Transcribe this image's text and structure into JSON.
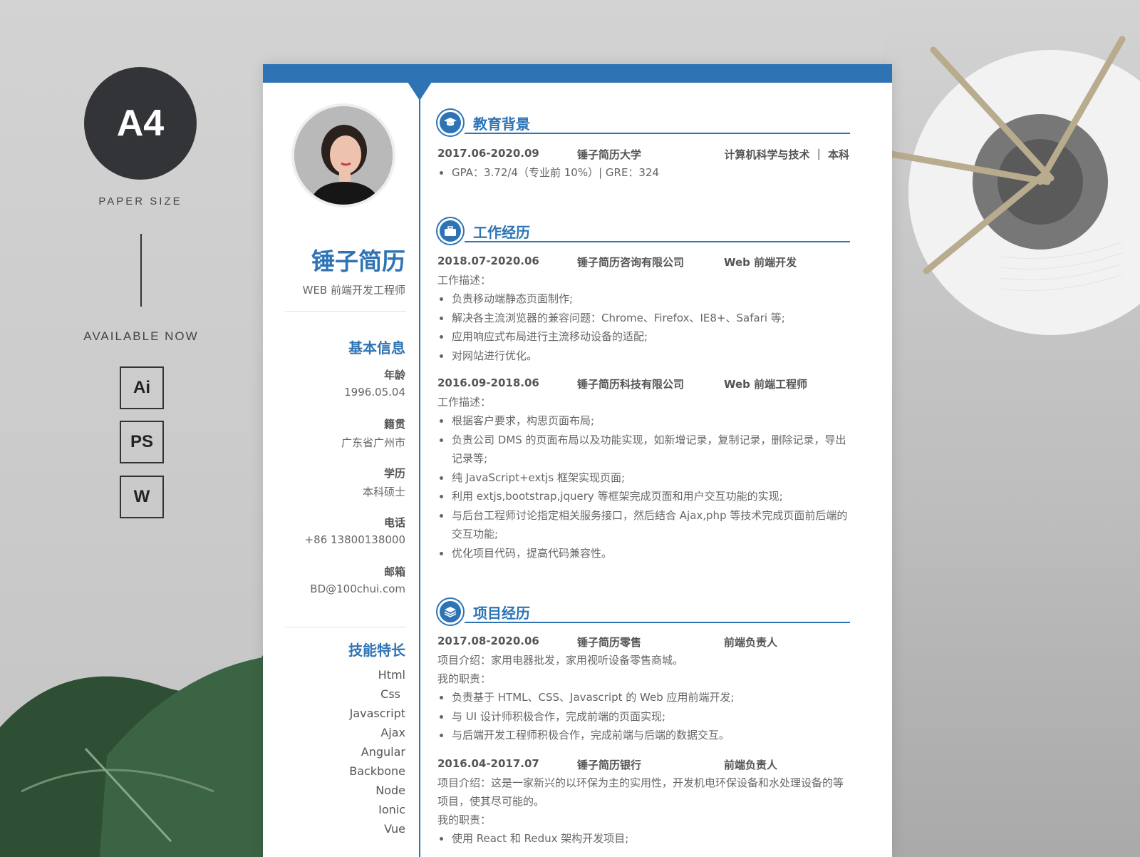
{
  "promo": {
    "badge": "A4",
    "paper_size": "PAPER SIZE",
    "available": "AVAILABLE NOW",
    "formats": [
      "Ai",
      "PS",
      "W"
    ]
  },
  "profile": {
    "name": "锤子简历",
    "role": "WEB 前端开发工程师"
  },
  "basic_info": {
    "heading": "基本信息",
    "items": [
      {
        "label": "年龄",
        "value": "1996.05.04"
      },
      {
        "label": "籍贯",
        "value": "广东省广州市"
      },
      {
        "label": "学历",
        "value": "本科硕士"
      },
      {
        "label": "电话",
        "value": "+86  13800138000"
      },
      {
        "label": "邮箱",
        "value": "BD@100chui.com"
      }
    ]
  },
  "skills": {
    "heading": "技能特长",
    "items": [
      "Html",
      "Css",
      "Javascript",
      "Ajax",
      "Angular",
      "Backbone",
      "Node",
      "Ionic",
      "Vue"
    ]
  },
  "education": {
    "heading": "教育背景",
    "date": "2017.06-2020.09",
    "school": "锤子简历大学",
    "major": "计算机科学与技术 ｜ 本科",
    "bullets": [
      "GPA：3.72/4（专业前 10%）| GRE：324"
    ]
  },
  "work": {
    "heading": "工作经历",
    "jobs": [
      {
        "date": "2018.07-2020.06",
        "company": "锤子简历咨询有限公司",
        "position": "Web 前端开发",
        "desc_label": "工作描述：",
        "bullets": [
          "负责移动端静态页面制作;",
          "解决各主流浏览器的兼容问题：Chrome、Firefox、IE8+、Safari 等;",
          "应用响应式布局进行主流移动设备的适配;",
          "对网站进行优化。"
        ]
      },
      {
        "date": "2016.09-2018.06",
        "company": "锤子简历科技有限公司",
        "position": "Web 前端工程师",
        "desc_label": "工作描述：",
        "bullets": [
          "根据客户要求，构思页面布局;",
          "负责公司 DMS 的页面布局以及功能实现，如新增记录，复制记录，删除记录，导出记录等;",
          "纯 JavaScript+extjs 框架实现页面;",
          "利用 extjs,bootstrap,jquery 等框架完成页面和用户交互功能的实现;",
          "与后台工程师讨论指定相关服务接口，然后结合 Ajax,php 等技术完成页面前后端的交互功能;",
          "优化项目代码，提高代码兼容性。"
        ]
      }
    ]
  },
  "projects": {
    "heading": "项目经历",
    "items": [
      {
        "date": "2017.08-2020.06",
        "name": "锤子简历零售",
        "role": "前端负责人",
        "intro": "项目介绍：家用电器批发，家用视听设备零售商城。",
        "duty_label": "我的职责：",
        "bullets": [
          "负责基于 HTML、CSS、Javascript 的 Web 应用前端开发;",
          "与 UI 设计师积极合作，完成前端的页面实现;",
          "与后端开发工程师积极合作，完成前端与后端的数据交互。"
        ]
      },
      {
        "date": "2016.04-2017.07",
        "name": "锤子简历银行",
        "role": "前端负责人",
        "intro": "项目介绍：这是一家新兴的以环保为主的实用性，开发机电环保设备和水处理设备的等项目，使其尽可能的。",
        "duty_label": "我的职责：",
        "bullets": [
          "使用 React 和 Redux 架构开发项目;"
        ]
      }
    ]
  },
  "colors": {
    "accent": "#2e74b5",
    "dark": "#333437"
  }
}
